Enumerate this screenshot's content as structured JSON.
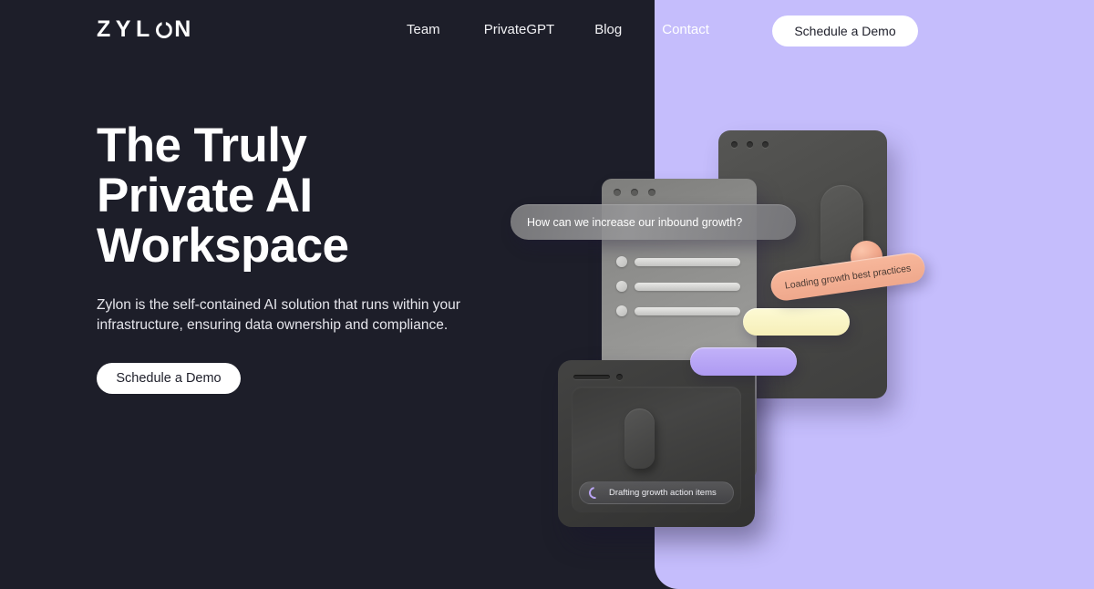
{
  "theme": {
    "background": "#1D1E29",
    "panel_purple": "#C5BDFC",
    "text_light": "#FFFFFF",
    "button_bg": "#FFFFFF",
    "button_text": "#20212C",
    "accent_salmon": "#F2A98D",
    "accent_yellow": "#FAF5C8",
    "accent_violet": "#B9A8F5",
    "spinner_violet": "#B9A4F2"
  },
  "header": {
    "logo": "ZYL",
    "logo_suffix": "N",
    "logo_full": "ZYLON",
    "nav": [
      {
        "label": "Team"
      },
      {
        "label": "PrivateGPT"
      },
      {
        "label": "Blog"
      },
      {
        "label": "Contact"
      }
    ],
    "cta_label": "Schedule a Demo"
  },
  "hero": {
    "headline_lines": [
      "The Truly",
      "Private AI",
      "Workspace"
    ],
    "subhead": "Zylon is the self-contained AI solution that runs within your infrastructure, ensuring data ownership and compliance.",
    "cta_label": "Schedule a Demo"
  },
  "illustration": {
    "chat_bubble": {
      "text": "How can we increase our inbound growth?"
    },
    "salmon_pill": {
      "text": "Loading growth best practices"
    },
    "status_bar": {
      "text": "Drafting growth action items",
      "icon": "spinner-icon"
    },
    "list_rows": [
      1,
      2,
      3
    ],
    "window_dots": [
      1,
      2,
      3
    ]
  }
}
